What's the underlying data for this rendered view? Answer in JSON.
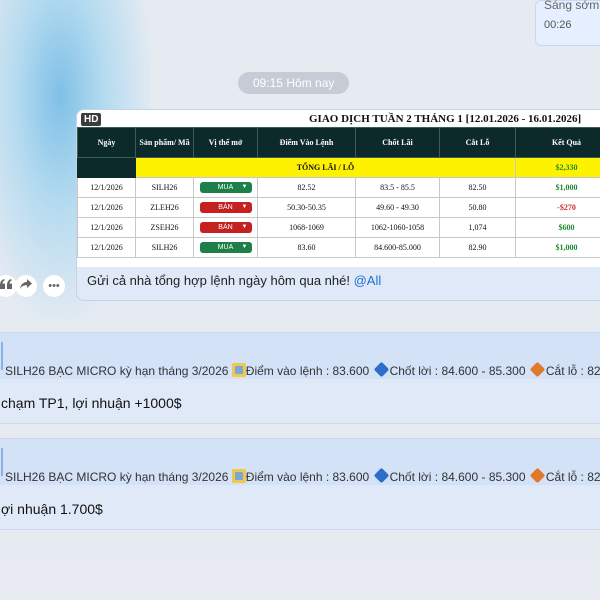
{
  "previous_message": {
    "text": "Sáng sớm",
    "time": "00:26"
  },
  "time_divider": "09:15 Hôm nay",
  "trade_image": {
    "badge": "HD",
    "title": "GIAO DỊCH TUẦN 2 THÁNG 1 [12.01.2026 - 16.01.2026]",
    "headers": [
      "Ngày",
      "Sản phẩm/ Mã",
      "Vị thế mở",
      "Điểm Vào Lệnh",
      "Chốt Lãi",
      "Cắt Lỗ",
      "Kết Quả"
    ],
    "total_label": "TỔNG LÃI / LỖ",
    "total_value": "$2,330",
    "rows": [
      {
        "date": "12/1/2026",
        "symbol": "SILH26",
        "position": "MUA",
        "entry": "82.52",
        "take_profit": "83.5 - 85.5",
        "stop_loss": "82.50",
        "result": "$1,000",
        "result_color": "#1e8a2e"
      },
      {
        "date": "12/1/2026",
        "symbol": "ZLEH26",
        "position": "BÁN",
        "entry": "50.30-50.35",
        "take_profit": "49.60 - 49.30",
        "stop_loss": "50.80",
        "result": "-$270",
        "result_color": "#d12b2b"
      },
      {
        "date": "12/1/2026",
        "symbol": "ZSEH26",
        "position": "BÁN",
        "entry": "1068-1069",
        "take_profit": "1062-1060-1058",
        "stop_loss": "1,074",
        "result": "$600",
        "result_color": "#1e8a2e"
      },
      {
        "date": "12/1/2026",
        "symbol": "SILH26",
        "position": "MUA",
        "entry": "83.60",
        "take_profit": "84.600-85.000",
        "stop_loss": "82.90",
        "result": "$1,000",
        "result_color": "#1e8a2e"
      }
    ]
  },
  "caption": {
    "text": "Gửi cả nhà tổng hợp lệnh ngày hôm qua nhé!",
    "mention": "@All"
  },
  "actions": [
    "quote-icon",
    "share-icon",
    "more-icon"
  ],
  "messages": [
    {
      "quote_text": "SILH26 BẠC MICRO kỳ hạn tháng 3/2026",
      "entry_label": "Điểm vào lệnh : 83.600",
      "tp_label": "Chốt lời : 84.600 - 85.300",
      "sl_label": "Cắt lỗ : 82.",
      "body": "chạm TP1, lợi nhuận +1000$"
    },
    {
      "quote_text": "SILH26 BẠC MICRO kỳ hạn tháng 3/2026",
      "entry_label": "Điểm vào lệnh : 83.600",
      "tp_label": "Chốt lời : 84.600 - 85.300",
      "sl_label": "Cắt lỗ : 82.",
      "body": "ợi nhuận 1.700$"
    }
  ],
  "colors": {
    "buy": "#1e8048",
    "sell": "#c62121",
    "header_bg": "#0d2a2a",
    "total_bg": "#fff200",
    "mention": "#1f6fd4"
  }
}
